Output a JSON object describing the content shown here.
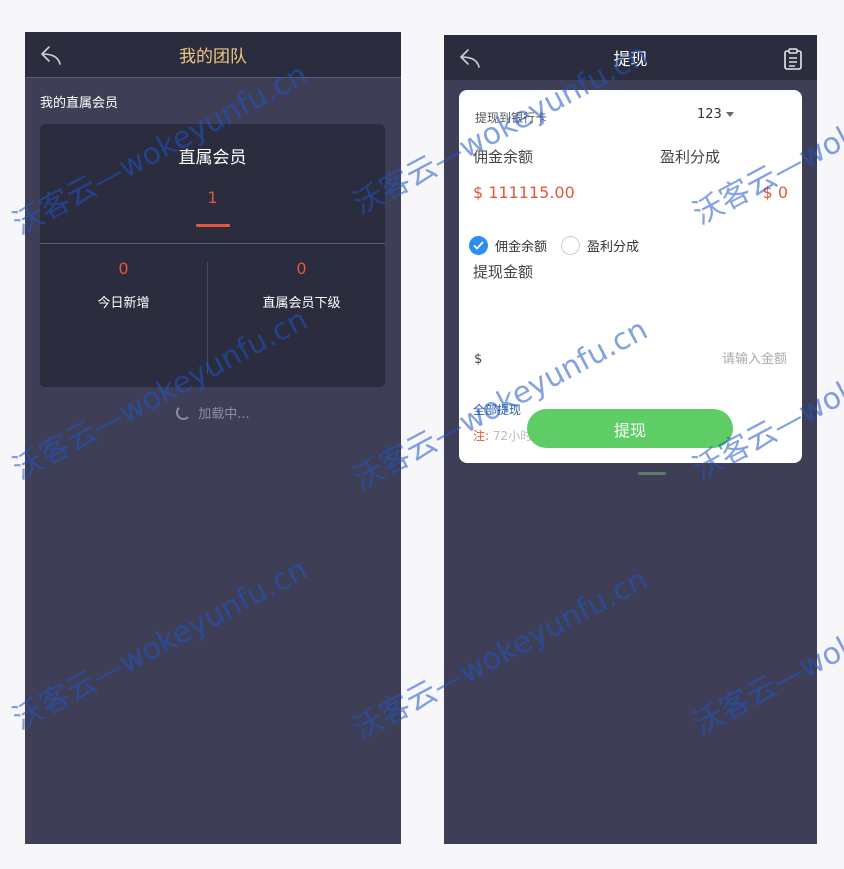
{
  "colors": {
    "screen_bg": "#3e3f56",
    "navbar_bg": "#2b2c3d",
    "title_gold": "#f0c682",
    "title_white": "#ffffff",
    "accent_red": "#e4573c",
    "accent_green": "#5fcd66",
    "accent_blue": "#2f8cf0",
    "watermark": "#1f56c8"
  },
  "left_screen": {
    "title": "我的团队",
    "back_icon": "back-arrow-icon",
    "section_label": "我的直属会员",
    "card": {
      "title": "直属会员",
      "count": "1",
      "stats": [
        {
          "value": "0",
          "label": "今日新增"
        },
        {
          "value": "0",
          "label": "直属会员下级"
        }
      ]
    },
    "loading_text": "加载中..."
  },
  "right_screen": {
    "title": "提现",
    "back_icon": "back-arrow-icon",
    "right_icon": "clipboard-icon",
    "bank_label": "提现到银行卡",
    "bank_select_value": "123",
    "balance_labels": [
      "佣金余额",
      "盈利分成"
    ],
    "balance_values": [
      "$ 111115.00",
      "$ 0"
    ],
    "radio_options": [
      {
        "label": "佣金余额",
        "checked": true
      },
      {
        "label": "盈利分成",
        "checked": false
      }
    ],
    "amount_label": "提现金额",
    "currency_symbol": "$",
    "amount_placeholder": "请输入金额",
    "all_withdraw_link": "全部提现",
    "note_prefix": "注:",
    "note_text": "72小时内到账",
    "submit_label": "提现"
  },
  "watermark_text": "沃客云—wokeyunfu.cn"
}
